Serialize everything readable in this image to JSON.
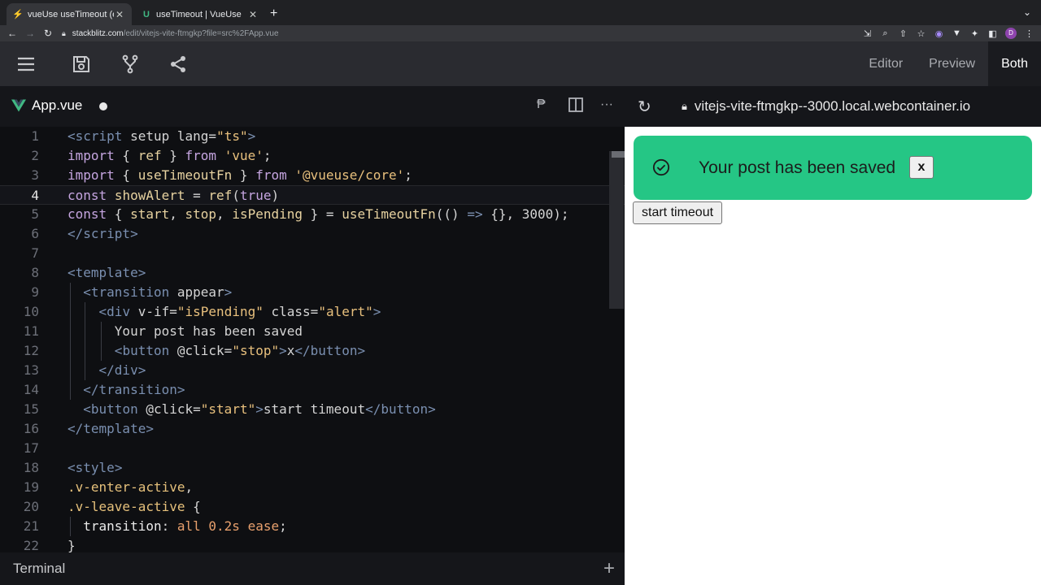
{
  "browser": {
    "tabs": [
      {
        "title": "vueUse useTimeout (end) - Sta",
        "active": true,
        "icon": "stackblitz-bolt-icon"
      },
      {
        "title": "useTimeout | VueUse",
        "active": false,
        "icon": "vueuse-icon"
      }
    ],
    "url_host": "stackblitz.com",
    "url_path": "/edit/vitejs-vite-ftmgkp?file=src%2FApp.vue",
    "profile_initial": "D"
  },
  "header": {
    "views": [
      "Editor",
      "Preview",
      "Both"
    ],
    "active_view": "Both"
  },
  "editor": {
    "file_name": "App.vue",
    "terminal_label": "Terminal",
    "current_line": 4
  },
  "preview": {
    "url": "vitejs-vite-ftmgkp--3000.local.webcontainer.io",
    "alert_text": "Your post has been saved",
    "alert_close_label": "x",
    "start_button_label": "start timeout",
    "alert_color": "#25c685"
  },
  "code_lines": [
    [
      [
        "t-tag",
        "<"
      ],
      [
        "t-tag",
        "script"
      ],
      [
        "t-plain",
        " "
      ],
      [
        "t-attr",
        "setup"
      ],
      [
        "t-plain",
        " "
      ],
      [
        "t-attr",
        "lang"
      ],
      [
        "t-plain",
        "="
      ],
      [
        "t-str",
        "\"ts\""
      ],
      [
        "t-tag",
        ">"
      ]
    ],
    [
      [
        "t-kw",
        "import"
      ],
      [
        "t-plain",
        " { "
      ],
      [
        "t-fn",
        "ref"
      ],
      [
        "t-plain",
        " } "
      ],
      [
        "t-kw",
        "from"
      ],
      [
        "t-plain",
        " "
      ],
      [
        "t-str",
        "'vue'"
      ],
      [
        "t-plain",
        ";"
      ]
    ],
    [
      [
        "t-kw",
        "import"
      ],
      [
        "t-plain",
        " { "
      ],
      [
        "t-fn",
        "useTimeoutFn"
      ],
      [
        "t-plain",
        " } "
      ],
      [
        "t-kw",
        "from"
      ],
      [
        "t-plain",
        " "
      ],
      [
        "t-str",
        "'@vueuse/core'"
      ],
      [
        "t-plain",
        ";"
      ]
    ],
    [
      [
        "t-kw",
        "const"
      ],
      [
        "t-plain",
        " "
      ],
      [
        "t-fn",
        "showAlert"
      ],
      [
        "t-plain",
        " = "
      ],
      [
        "t-fn",
        "ref"
      ],
      [
        "t-plain",
        "("
      ],
      [
        "t-kw",
        "true"
      ],
      [
        "t-plain",
        ")"
      ]
    ],
    [
      [
        "t-kw",
        "const"
      ],
      [
        "t-plain",
        " { "
      ],
      [
        "t-fn",
        "start"
      ],
      [
        "t-plain",
        ", "
      ],
      [
        "t-fn",
        "stop"
      ],
      [
        "t-plain",
        ", "
      ],
      [
        "t-fn",
        "isPending"
      ],
      [
        "t-plain",
        " } = "
      ],
      [
        "t-fn",
        "useTimeoutFn"
      ],
      [
        "t-plain",
        "(() "
      ],
      [
        "t-op",
        "=>"
      ],
      [
        "t-plain",
        " {}, "
      ],
      [
        "t-num",
        "3000"
      ],
      [
        "t-plain",
        ");"
      ]
    ],
    [
      [
        "t-tag",
        "</"
      ],
      [
        "t-tag",
        "script"
      ],
      [
        "t-tag",
        ">"
      ]
    ],
    [],
    [
      [
        "t-tag",
        "<"
      ],
      [
        "t-tag",
        "template"
      ],
      [
        "t-tag",
        ">"
      ]
    ],
    [
      [
        "t-plain",
        "  "
      ],
      [
        "t-tag",
        "<"
      ],
      [
        "t-tag",
        "transition"
      ],
      [
        "t-plain",
        " "
      ],
      [
        "t-attr",
        "appear"
      ],
      [
        "t-tag",
        ">"
      ]
    ],
    [
      [
        "t-plain",
        "    "
      ],
      [
        "t-tag",
        "<"
      ],
      [
        "t-tag",
        "div"
      ],
      [
        "t-plain",
        " "
      ],
      [
        "t-attr",
        "v-if"
      ],
      [
        "t-plain",
        "="
      ],
      [
        "t-str",
        "\"isPending\""
      ],
      [
        "t-plain",
        " "
      ],
      [
        "t-attr",
        "class"
      ],
      [
        "t-plain",
        "="
      ],
      [
        "t-str",
        "\"alert\""
      ],
      [
        "t-tag",
        ">"
      ]
    ],
    [
      [
        "t-plain",
        "      Your post has been saved"
      ]
    ],
    [
      [
        "t-plain",
        "      "
      ],
      [
        "t-tag",
        "<"
      ],
      [
        "t-tag",
        "button"
      ],
      [
        "t-plain",
        " "
      ],
      [
        "t-attr",
        "@click"
      ],
      [
        "t-plain",
        "="
      ],
      [
        "t-str",
        "\"stop\""
      ],
      [
        "t-tag",
        ">"
      ],
      [
        "t-plain",
        "x"
      ],
      [
        "t-tag",
        "</"
      ],
      [
        "t-tag",
        "button"
      ],
      [
        "t-tag",
        ">"
      ]
    ],
    [
      [
        "t-plain",
        "    "
      ],
      [
        "t-tag",
        "</"
      ],
      [
        "t-tag",
        "div"
      ],
      [
        "t-tag",
        ">"
      ]
    ],
    [
      [
        "t-plain",
        "  "
      ],
      [
        "t-tag",
        "</"
      ],
      [
        "t-tag",
        "transition"
      ],
      [
        "t-tag",
        ">"
      ]
    ],
    [
      [
        "t-plain",
        "  "
      ],
      [
        "t-tag",
        "<"
      ],
      [
        "t-tag",
        "button"
      ],
      [
        "t-plain",
        " "
      ],
      [
        "t-attr",
        "@click"
      ],
      [
        "t-plain",
        "="
      ],
      [
        "t-str",
        "\"start\""
      ],
      [
        "t-tag",
        ">"
      ],
      [
        "t-plain",
        "start timeout"
      ],
      [
        "t-tag",
        "</"
      ],
      [
        "t-tag",
        "button"
      ],
      [
        "t-tag",
        ">"
      ]
    ],
    [
      [
        "t-tag",
        "</"
      ],
      [
        "t-tag",
        "template"
      ],
      [
        "t-tag",
        ">"
      ]
    ],
    [],
    [
      [
        "t-tag",
        "<"
      ],
      [
        "t-tag",
        "style"
      ],
      [
        "t-tag",
        ">"
      ]
    ],
    [
      [
        "t-sel",
        ".v-enter-active"
      ],
      [
        "t-plain",
        ","
      ]
    ],
    [
      [
        "t-sel",
        ".v-leave-active"
      ],
      [
        "t-plain",
        " {"
      ]
    ],
    [
      [
        "t-plain",
        "  "
      ],
      [
        "t-prop",
        "transition"
      ],
      [
        "t-plain",
        ": "
      ],
      [
        "t-val",
        "all"
      ],
      [
        "t-plain",
        " "
      ],
      [
        "t-val",
        "0.2s"
      ],
      [
        "t-plain",
        " "
      ],
      [
        "t-val",
        "ease"
      ],
      [
        "t-plain",
        ";"
      ]
    ],
    [
      [
        "t-plain",
        "}"
      ]
    ]
  ]
}
